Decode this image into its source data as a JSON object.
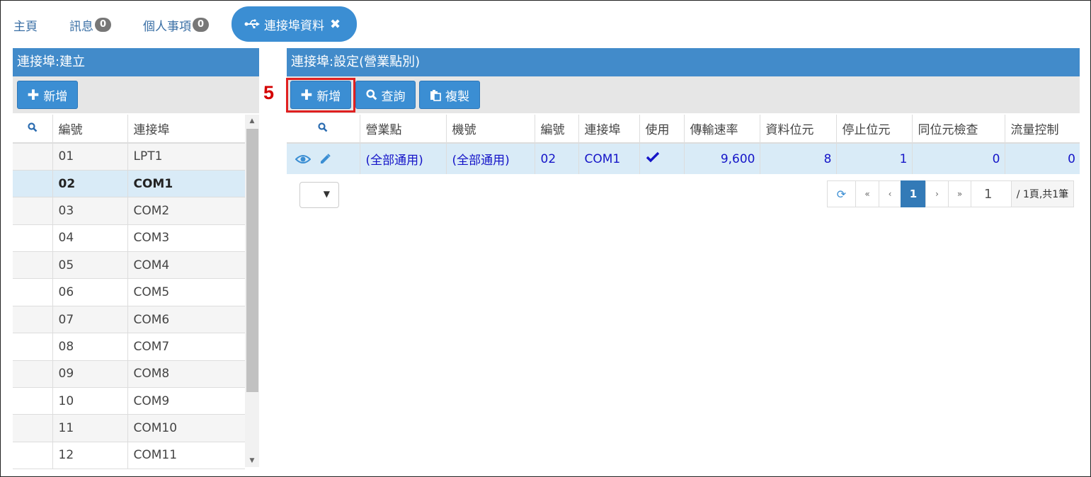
{
  "tabs": [
    {
      "label": "主頁"
    },
    {
      "label": "訊息",
      "badge": "0"
    },
    {
      "label": "個人事項",
      "badge": "0"
    },
    {
      "label": "連接埠資料",
      "icon": "usb-icon",
      "active": true
    }
  ],
  "left_panel": {
    "title": "連接埠:建立",
    "add_label": "新增",
    "columns": [
      "編號",
      "連接埠"
    ],
    "rows": [
      {
        "id": "01",
        "port": "LPT1"
      },
      {
        "id": "02",
        "port": "COM1",
        "selected": true
      },
      {
        "id": "03",
        "port": "COM2"
      },
      {
        "id": "04",
        "port": "COM3"
      },
      {
        "id": "05",
        "port": "COM4"
      },
      {
        "id": "06",
        "port": "COM5"
      },
      {
        "id": "07",
        "port": "COM6"
      },
      {
        "id": "08",
        "port": "COM7"
      },
      {
        "id": "09",
        "port": "COM8"
      },
      {
        "id": "10",
        "port": "COM9"
      },
      {
        "id": "11",
        "port": "COM10"
      },
      {
        "id": "12",
        "port": "COM11"
      }
    ]
  },
  "right_panel": {
    "title": "連接埠:設定(營業點別)",
    "add_label": "新增",
    "query_label": "查詢",
    "copy_label": "複製",
    "columns": [
      "營業點",
      "機號",
      "編號",
      "連接埠",
      "使用",
      "傳輸速率",
      "資料位元",
      "停止位元",
      "同位元檢查",
      "流量控制"
    ],
    "row": {
      "branch": "(全部通用)",
      "machine": "(全部通用)",
      "id": "02",
      "port": "COM1",
      "enabled": true,
      "baud": "9,600",
      "data_bits": "8",
      "stop_bits": "1",
      "parity": "0",
      "flow": "0"
    },
    "pager": {
      "first": "«",
      "prev": "‹",
      "current": "1",
      "next": "›",
      "last": "»",
      "page_input": "1",
      "info": "/ 1頁,共1筆"
    }
  },
  "annotation": {
    "step": "5"
  },
  "colors": {
    "accent": "#428bca",
    "highlight": "#e02020",
    "selected_row": "#d9ebf7"
  }
}
